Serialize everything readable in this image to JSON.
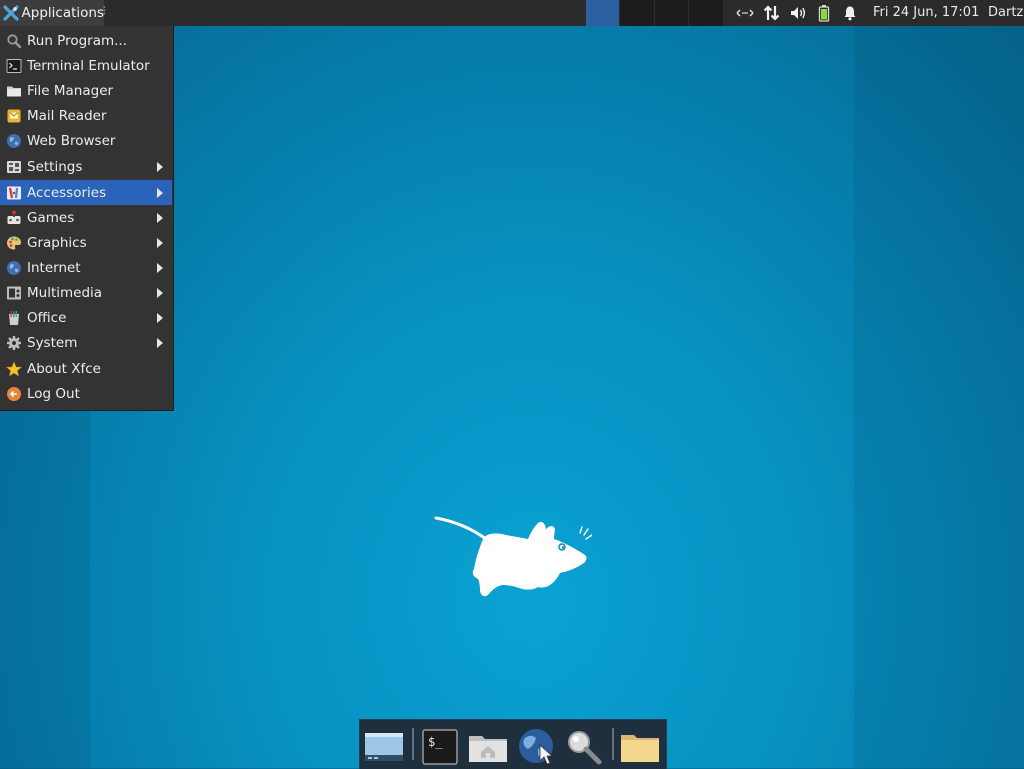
{
  "top_panel": {
    "applications_label": "Applications",
    "clock": "Fri 24 Jun, 17:01",
    "user": "Dartz"
  },
  "menu": {
    "items": [
      {
        "label": "Run Program...",
        "icon": "search-icon",
        "submenu": false
      },
      {
        "label": "Terminal Emulator",
        "icon": "terminal-icon",
        "submenu": false
      },
      {
        "label": "File Manager",
        "icon": "folder-icon",
        "submenu": false
      },
      {
        "label": "Mail Reader",
        "icon": "mail-icon",
        "submenu": false
      },
      {
        "label": "Web Browser",
        "icon": "globe-icon",
        "submenu": false
      },
      {
        "label": "Settings",
        "icon": "settings-icon",
        "submenu": true
      },
      {
        "label": "Accessories",
        "icon": "accessories-icon",
        "submenu": true,
        "highlighted": true
      },
      {
        "label": "Games",
        "icon": "games-icon",
        "submenu": true
      },
      {
        "label": "Graphics",
        "icon": "palette-icon",
        "submenu": true
      },
      {
        "label": "Internet",
        "icon": "globe-icon",
        "submenu": true
      },
      {
        "label": "Multimedia",
        "icon": "multimedia-icon",
        "submenu": true
      },
      {
        "label": "Office",
        "icon": "office-icon",
        "submenu": true
      },
      {
        "label": "System",
        "icon": "gear-icon",
        "submenu": true
      },
      {
        "label": "About Xfce",
        "icon": "star-icon",
        "submenu": false
      },
      {
        "label": "Log Out",
        "icon": "logout-icon",
        "submenu": false
      }
    ]
  },
  "dock": {
    "items": [
      "show-desktop-icon",
      "terminal-icon",
      "home-folder-icon",
      "web-browser-icon",
      "app-finder-icon",
      "folder-icon"
    ]
  },
  "colors": {
    "panel": "#2b2b2b",
    "menu_bg": "#333333",
    "highlight": "#2a63b9",
    "desktop": "#0792c2"
  }
}
